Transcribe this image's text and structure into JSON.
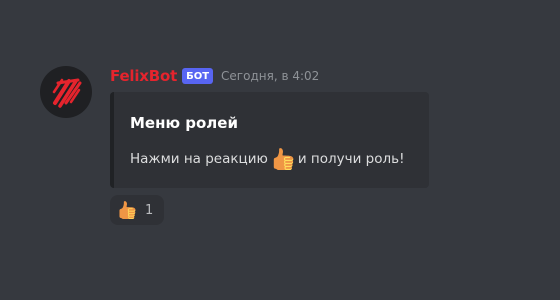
{
  "message": {
    "author": {
      "name": "FelixBot",
      "tag": "БОТ",
      "name_color": "#e5242d",
      "avatar_icon": "felixbot-logo-icon"
    },
    "timestamp": "Сегодня, в 4:02",
    "embed": {
      "title": "Меню ролей",
      "description_before": "Нажми на реакцию",
      "description_emoji": "thumbs-up-icon",
      "description_after": "и получи роль!"
    },
    "reactions": [
      {
        "emoji": "thumbs-up-icon",
        "count": "1"
      }
    ]
  },
  "colors": {
    "background": "#36393f",
    "embed_background": "#2f3136",
    "bot_tag": "#5865f2"
  }
}
